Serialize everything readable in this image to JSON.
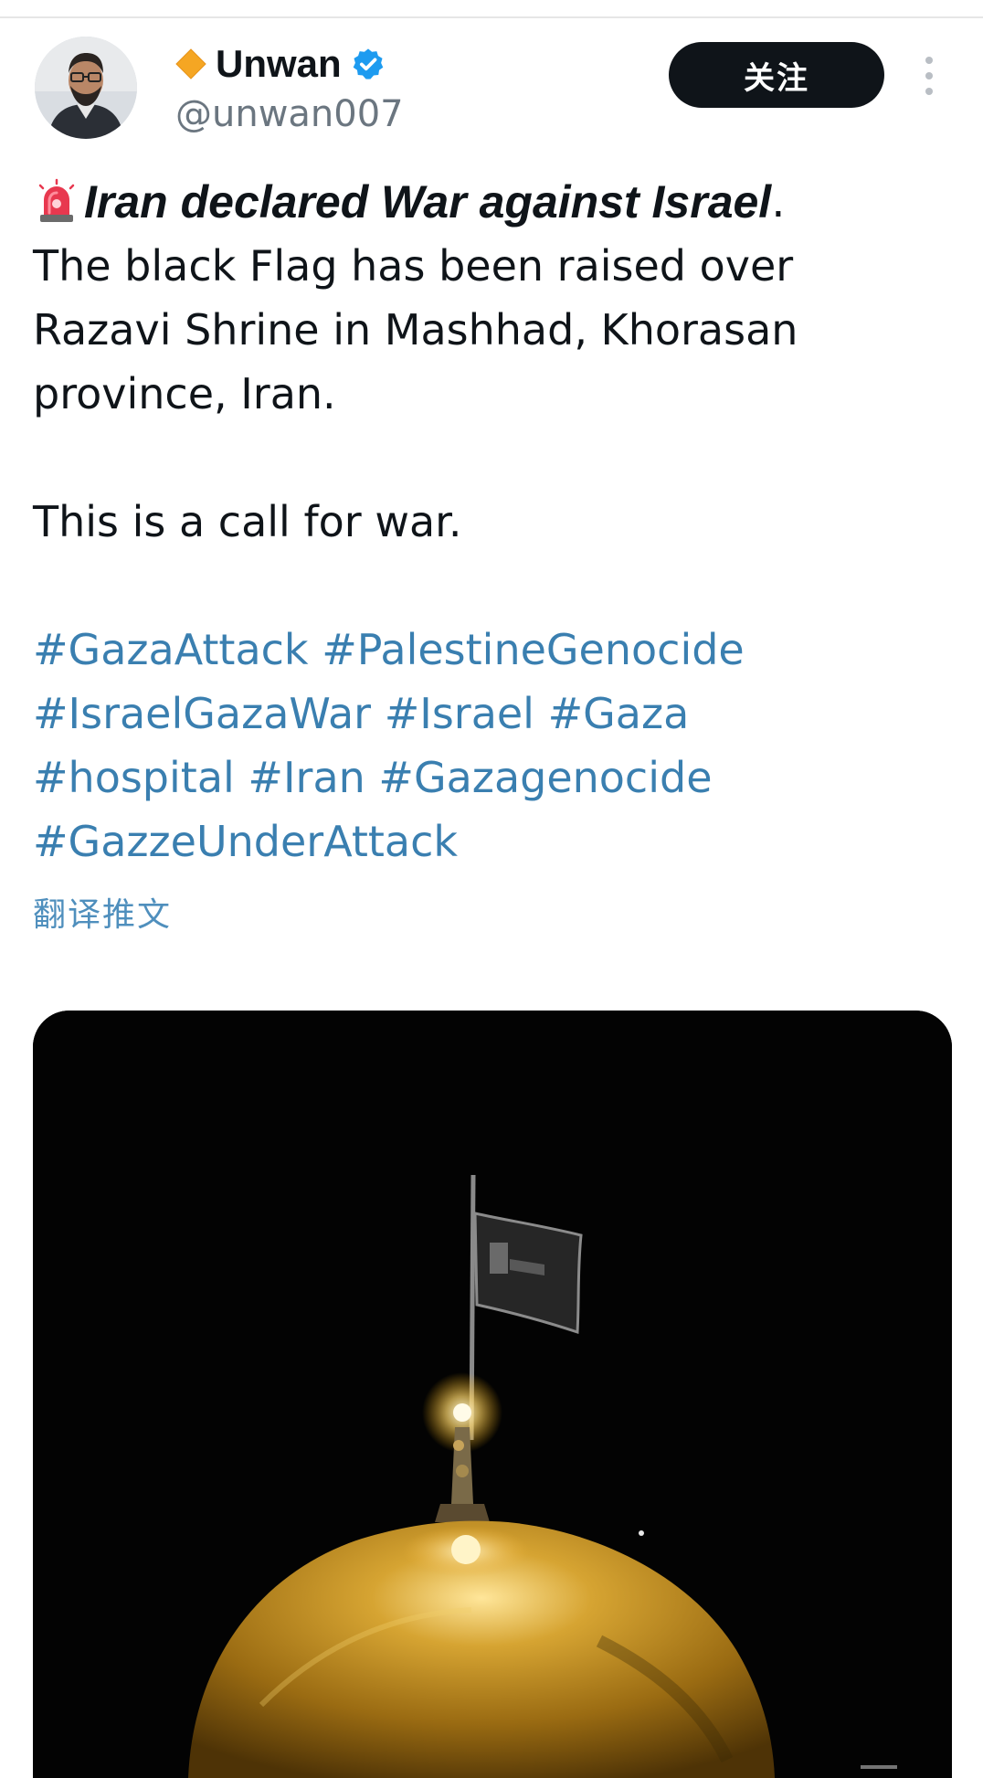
{
  "author": {
    "display_name": "Unwan",
    "handle": "@unwan007",
    "avatar": "avatar",
    "name_badge_icon": "orange-diamond-icon",
    "verified_icon": "verified-badge-icon"
  },
  "actions": {
    "follow_label": "关注",
    "more_icon": "more-vertical-icon"
  },
  "tweet": {
    "headline": "Iran declared War against Israel",
    "headline_punct": ".",
    "siren_icon": "siren-icon",
    "body_lines": [
      "The black Flag has been raised over",
      "Razavi Shrine in Mashhad, Khorasan",
      "province, Iran."
    ],
    "call_line": "This is a call for war.",
    "hashtag_lines": [
      [
        "#GazaAttack",
        "#PalestineGenocide"
      ],
      [
        "#IsraelGazaWar",
        "#Israel",
        "#Gaza"
      ],
      [
        "#hospital",
        "#Iran",
        "#Gazagenocide"
      ],
      [
        "#GazzeUnderAttack"
      ]
    ],
    "translate_label": "翻译推文"
  },
  "media": {
    "type": "photo",
    "subject": "shrine-dome-flag-photo"
  },
  "colors": {
    "follow_button_bg": "#0f1419",
    "hashtag": "#3a7fb0",
    "handle": "#6b7680",
    "verified": "#1d9bf0"
  }
}
